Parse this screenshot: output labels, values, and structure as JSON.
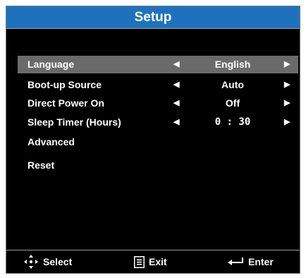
{
  "title": "Setup",
  "menu": {
    "items": [
      {
        "label": "Language",
        "value": "English",
        "selected": true
      },
      {
        "label": "Boot-up Source",
        "value": "Auto"
      },
      {
        "label": "Direct Power On",
        "value": "Off"
      },
      {
        "label": "Sleep Timer (Hours)",
        "value": "0 : 30"
      },
      {
        "label": "Advanced"
      },
      {
        "label": "Reset"
      }
    ]
  },
  "footer": {
    "select_label": "Select",
    "exit_label": "Exit",
    "enter_label": "Enter"
  },
  "icons": {
    "select": "four-way-arrow-icon",
    "exit": "menu-button-icon",
    "enter": "return-arrow-icon",
    "left_arrow": "triangle-left-icon",
    "right_arrow": "triangle-right-icon"
  },
  "colors": {
    "title_bar": "#1e72bd",
    "background": "#000000",
    "selected_row": "#6a6a6a",
    "text": "#ffffff"
  }
}
